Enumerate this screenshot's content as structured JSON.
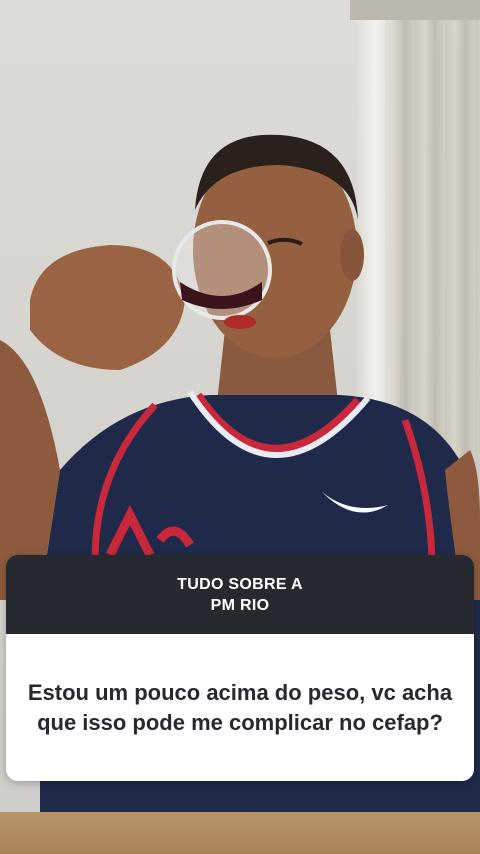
{
  "story": {
    "question_box": {
      "header_line1": "TUDO SOBRE A",
      "header_line2": "PM RIO",
      "question": "Estou um pouco acima do peso, vc acha que isso pode me complicar no cefap?"
    },
    "colors": {
      "card_header_bg": "#262a30",
      "card_body_bg": "#ffffff",
      "jersey": "#1f2a4a",
      "jersey_trim": "#c8283a"
    }
  }
}
